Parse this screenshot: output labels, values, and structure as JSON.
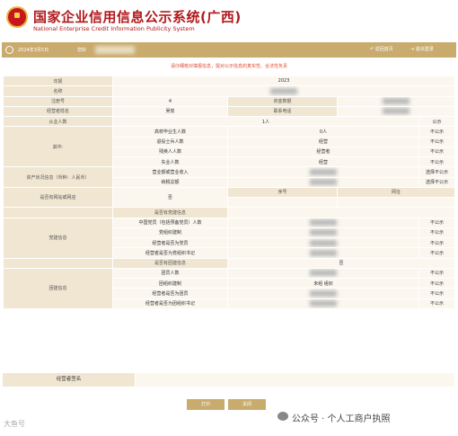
{
  "header": {
    "title": "国家企业信用信息公示系统(广西)",
    "subtitle": "National Enterprise Credit Information Publicity System"
  },
  "toolbar": {
    "date": "2024年3月5日",
    "welcome": "您好",
    "back_label": "返回首页",
    "logout_label": "退出登录"
  },
  "notice": "请仔细核对填报信息，需对公示信息的真实性、合法性负责",
  "rows": [
    {
      "type": "kv",
      "label": "年报",
      "value": "2023"
    },
    {
      "type": "kv",
      "label": "名称",
      "value": ""
    },
    {
      "type": "kv2",
      "label": "注册号",
      "value": "4",
      "label2": "资金数额",
      "value2": ""
    },
    {
      "type": "kv2",
      "label": "经营者姓名",
      "value": "吴俊",
      "label2": "联系电话",
      "value2": ""
    },
    {
      "type": "head",
      "label": "从业人数",
      "value": "1人",
      "flag": "公示"
    },
    {
      "type": "sub",
      "group": "其中:",
      "label": "高校毕业生人数",
      "value": "0人",
      "flag": "不公示"
    },
    {
      "type": "sub",
      "group": "",
      "label": "退役士兵人数",
      "value": "经营",
      "flag": "不公示"
    },
    {
      "type": "sub",
      "group": "",
      "label": "残疾人人数",
      "value": "经营者",
      "flag": "不公示"
    },
    {
      "type": "sub",
      "group": "",
      "label": "失业人数",
      "value": "经营",
      "flag": "不公示"
    },
    {
      "type": "sub",
      "group": "资产状况信息（币种：人民币）",
      "label": "营业额或营业收入",
      "value": "",
      "flag": "选择不公示"
    },
    {
      "type": "sub",
      "group": "",
      "label": "纳税总额",
      "value": "",
      "flag": "选择不公示"
    },
    {
      "type": "web",
      "label": "是否有网站或网店",
      "value": "否",
      "col1": "序号",
      "col2": "网址"
    },
    {
      "type": "web2"
    },
    {
      "type": "sec",
      "group": "",
      "label": "是否有党建信息",
      "value": "",
      "flag": ""
    },
    {
      "type": "sub",
      "group": "",
      "label": "中国党员（包括预备党员）人数",
      "value": "",
      "flag": "不公示"
    },
    {
      "type": "sub",
      "group": "党建信息",
      "label": "党组织建制",
      "value": "",
      "flag": "不公示"
    },
    {
      "type": "sub",
      "group": "",
      "label": "经营者是否为党员",
      "value": "",
      "flag": "不公示"
    },
    {
      "type": "sub",
      "group": "",
      "label": "经营者是否为党组织书记",
      "value": "",
      "flag": "不公示"
    },
    {
      "type": "sec",
      "group": "",
      "label": "是否有团建信息",
      "value": "否",
      "flag": ""
    },
    {
      "type": "sub",
      "group": "",
      "label": "团员人数",
      "value": "",
      "flag": "不公示"
    },
    {
      "type": "sub",
      "group": "团建信息",
      "label": "团组织建制",
      "value": "未组    组织",
      "flag": "不公示"
    },
    {
      "type": "sub",
      "group": "",
      "label": "经营者是否为团员",
      "value": "",
      "flag": "不公示"
    },
    {
      "type": "sub",
      "group": "",
      "label": "经营者是否为团组织书记",
      "value": "",
      "flag": "不公示"
    }
  ],
  "bottom": {
    "label": "经营者签名"
  },
  "buttons": {
    "print": "打印",
    "close": "关闭"
  },
  "watermark": {
    "text": "公众号 · 个人工商户执照",
    "corner": "大鱼号"
  }
}
